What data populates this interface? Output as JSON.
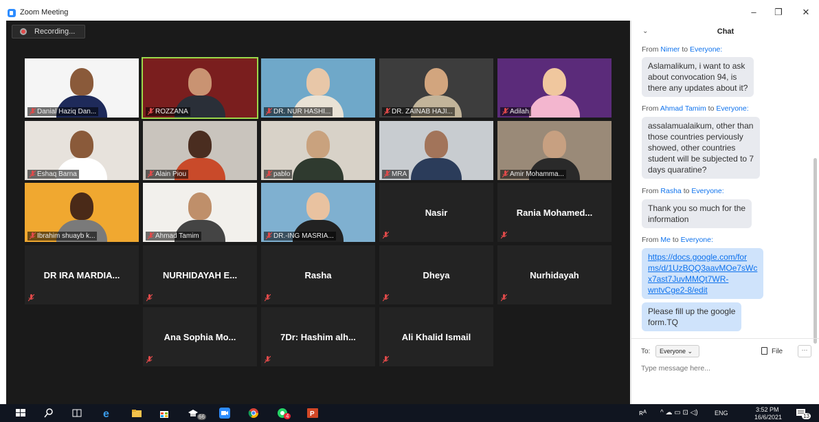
{
  "window": {
    "title": "Zoom Meeting",
    "minimize": "–",
    "restore": "❐",
    "close": "✕"
  },
  "recording": {
    "label": "Recording..."
  },
  "participants": [
    {
      "name": "Danial Haziq Dan..."
    },
    {
      "name": "ROZZANA"
    },
    {
      "name": "DR. NUR HASHI..."
    },
    {
      "name": "DR. ZAINAB HAJI..."
    },
    {
      "name": "Adilah"
    },
    {
      "name": "Eshaq Barna"
    },
    {
      "name": "Alain Piou"
    },
    {
      "name": "pablo"
    },
    {
      "name": "MRA"
    },
    {
      "name": "Amir Mohamma..."
    },
    {
      "name": "Ibrahim shuayb k..."
    },
    {
      "name": "Ahmad Tamim"
    },
    {
      "name": "DR.-ING MASRIA..."
    },
    {
      "name": "Nasir"
    },
    {
      "name": "Rania  Mohamed..."
    },
    {
      "name": "DR IRA MARDIA..."
    },
    {
      "name": "NURHIDAYAH E..."
    },
    {
      "name": "Rasha"
    },
    {
      "name": "Dheya"
    },
    {
      "name": "Nurhidayah"
    },
    {
      "name": "Ana Sophia Mo..."
    },
    {
      "name": "7Dr: Hashim alh..."
    },
    {
      "name": "Ali Khalid Ismail"
    }
  ],
  "chat": {
    "title": "Chat",
    "messages": [
      {
        "from_prefix": "From ",
        "sender": "Nimer",
        "to_word": " to ",
        "recipient": "Everyone:",
        "lines": [
          "Aslamalikum, i want to ask",
          "about convocation 94, is",
          "there any updates about it?"
        ]
      },
      {
        "from_prefix": "From ",
        "sender": "Ahmad Tamim",
        "to_word": " to ",
        "recipient": "Everyone:",
        "lines": [
          "assalamualaikum, other than",
          "those countries perviously",
          "showed, other countries",
          "student will be subjected to 7",
          "days quaratine?"
        ]
      },
      {
        "from_prefix": "From ",
        "sender": "Rasha",
        "to_word": " to ",
        "recipient": "Everyone:",
        "lines": [
          "Thank you so much for the",
          "information"
        ]
      },
      {
        "from_prefix": "From ",
        "sender": "Me",
        "to_word": " to ",
        "recipient": "Everyone:",
        "link_lines": [
          "https://docs.google.com/for",
          "ms/d/1UzBQQ3aavMOe7sWc",
          "x7ast7JuvMMQt7WR-",
          "wntvCge2-8/edit"
        ],
        "lines": [
          "Please fill up the google",
          "form.TQ"
        ]
      }
    ],
    "composer": {
      "to_label": "To:",
      "to_value": "Everyone ⌄",
      "file_label": "File",
      "more_label": "···",
      "placeholder": "Type message here..."
    }
  },
  "taskbar": {
    "time": "3:52 PM",
    "date": "16/6/2021",
    "lang": "ENG",
    "badge_chrome": "66",
    "badge_whatsapp": "4",
    "notif_count": "13"
  }
}
